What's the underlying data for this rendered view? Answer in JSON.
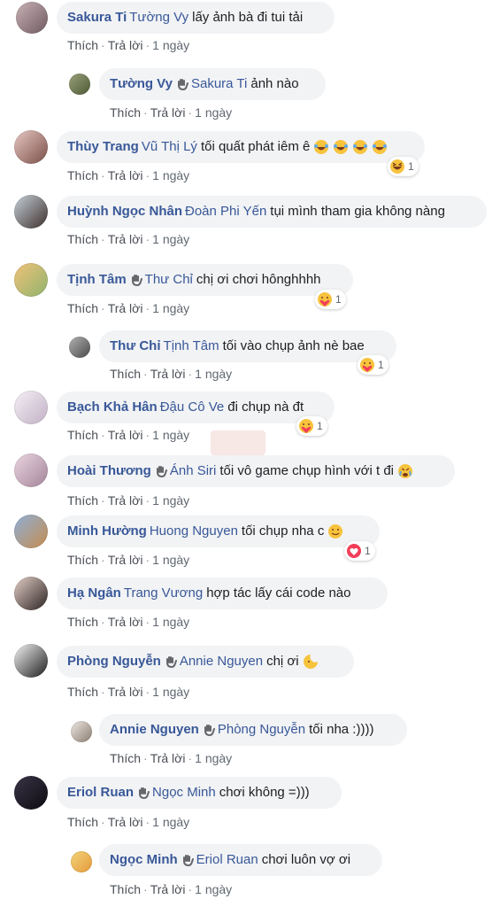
{
  "comments": [
    {
      "author": "Sakura Ti",
      "wave": false,
      "tag": "Tường Vy",
      "text": "lấy ảnh bà đi tui tải",
      "like": "Thích",
      "reply": "Trả lời",
      "time": "1 ngày",
      "reaction_count": null,
      "reaction_type": null,
      "avatar_colors": [
        "#c9b2b6",
        "#6e5a60"
      ]
    },
    {
      "author": "Tường Vy",
      "wave": true,
      "tag": "Sakura Ti",
      "text": "ảnh nào",
      "like": "Thích",
      "reply": "Trả lời",
      "time": "1 ngày",
      "reaction_count": null,
      "reaction_type": null,
      "avatar_colors": [
        "#9aa17a",
        "#4d5a36"
      ]
    },
    {
      "author": "Thùy Trang",
      "wave": false,
      "tag": "Vũ Thị Lý",
      "text": "tối quất phát iêm ê",
      "like": "Thích",
      "reply": "Trả lời",
      "time": "1 ngày",
      "reaction_count": "1",
      "reaction_type": "haha-icon",
      "avatar_colors": [
        "#e8c8c4",
        "#7a4e48"
      ]
    },
    {
      "author": "Huỳnh Ngọc Nhân",
      "wave": false,
      "tag": "Đoàn Phi Yến",
      "text": "tụi mình tham gia không nàng",
      "like": "Thích",
      "reply": "Trả lời",
      "time": "1 ngày",
      "reaction_count": null,
      "reaction_type": null,
      "avatar_colors": [
        "#c6d1d9",
        "#3d2f2c"
      ]
    },
    {
      "author": "Tịnh Tâm",
      "wave": true,
      "tag": "Thư Chỉ",
      "text": "chị ơi chơi hônghhhh",
      "like": "Thích",
      "reply": "Trả lời",
      "time": "1 ngày",
      "reaction_count": "1",
      "reaction_type": "care-icon",
      "avatar_colors": [
        "#f1c27a",
        "#8fb36c"
      ]
    },
    {
      "author": "Thư Chỉ",
      "wave": false,
      "tag": "Tịnh Tâm",
      "text": "tối vào chụp ảnh nè bae",
      "like": "Thích",
      "reply": "Trả lời",
      "time": "1 ngày",
      "reaction_count": "1",
      "reaction_type": "care-icon",
      "avatar_colors": [
        "#b3b3b3",
        "#4a4a4a"
      ]
    },
    {
      "author": "Bạch Khả Hân",
      "wave": false,
      "tag": "Đậu Cô Ve",
      "text": "đi chụp nà đt",
      "like": "Thích",
      "reply": "Trả lời",
      "time": "1 ngày",
      "reaction_count": "1",
      "reaction_type": "care-icon",
      "avatar_colors": [
        "#f4f0f4",
        "#c2b0c6"
      ]
    },
    {
      "author": "Hoài Thương",
      "wave": true,
      "tag": "Ánh Siri",
      "text": "tối vô game chụp hình với t đi",
      "like": "Thích",
      "reply": "Trả lời",
      "time": "1 ngày",
      "reaction_count": null,
      "reaction_type": null,
      "avatar_colors": [
        "#ebd5e0",
        "#a38599"
      ]
    },
    {
      "author": "Minh Hường",
      "wave": false,
      "tag": "Huong Nguyen",
      "text": "tối chụp nha c",
      "like": "Thích",
      "reply": "Trả lời",
      "time": "1 ngày",
      "reaction_count": "1",
      "reaction_type": "love-icon",
      "avatar_colors": [
        "#8fb0d6",
        "#c58b4f"
      ]
    },
    {
      "author": "Hạ Ngân",
      "wave": false,
      "tag": "Trang Vương",
      "text": "hợp tác lấy cái code nào",
      "like": "Thích",
      "reply": "Trả lời",
      "time": "1 ngày",
      "reaction_count": null,
      "reaction_type": null,
      "avatar_colors": [
        "#e4cfc8",
        "#2c2422"
      ]
    },
    {
      "author": "Phòng Nguyễn",
      "wave": true,
      "tag": "Annie Nguyen",
      "text": "chị ơi",
      "like": "Thích",
      "reply": "Trả lời",
      "time": "1 ngày",
      "reaction_count": null,
      "reaction_type": null,
      "avatar_colors": [
        "#f5f5f5",
        "#1d1d1d"
      ]
    },
    {
      "author": "Annie Nguyen",
      "wave": true,
      "tag": "Phòng Nguyễn",
      "text": "tối nha :))))",
      "like": "Thích",
      "reply": "Trả lời",
      "time": "1 ngày",
      "reaction_count": null,
      "reaction_type": null,
      "avatar_colors": [
        "#eee9e4",
        "#8a7c70"
      ]
    },
    {
      "author": "Eriol Ruan",
      "wave": true,
      "tag": "Ngọc Minh",
      "text": "chơi không =)))",
      "like": "Thích",
      "reply": "Trả lời",
      "time": "1 ngày",
      "reaction_count": null,
      "reaction_type": null,
      "avatar_colors": [
        "#3a3445",
        "#0d0b12"
      ]
    },
    {
      "author": "Ngọc Minh",
      "wave": true,
      "tag": "Eriol Ruan",
      "text": "chơi luôn vợ ơi",
      "like": "Thích",
      "reply": "Trả lời",
      "time": "1 ngày",
      "reaction_count": null,
      "reaction_type": null,
      "avatar_colors": [
        "#f3d37a",
        "#e59a3a"
      ]
    }
  ],
  "colors": {
    "link": "#385898",
    "bubble": "#f2f3f5",
    "meta": "#606770",
    "love": "#f33e58",
    "emoji": "#f7c33d"
  }
}
